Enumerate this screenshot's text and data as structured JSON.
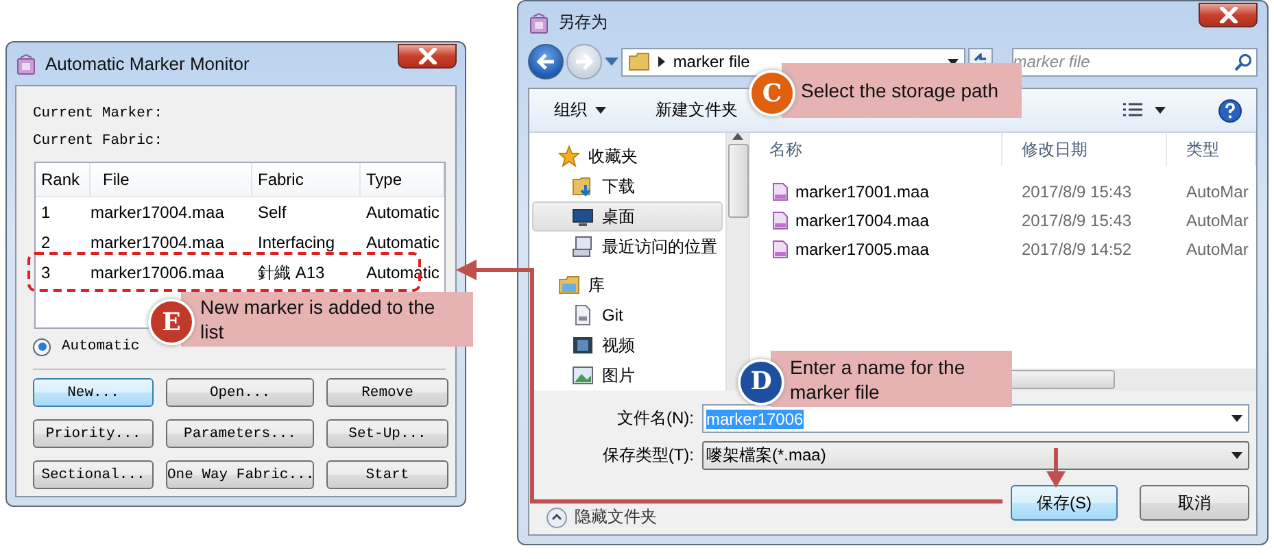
{
  "monitor": {
    "title": "Automatic Marker Monitor",
    "info": [
      "Current Marker:",
      "Current Fabric:"
    ],
    "list": {
      "columns": [
        "Rank",
        "File",
        "Fabric",
        "Type"
      ],
      "rows": [
        {
          "cells": [
            "1",
            "marker17004.maa",
            "Self",
            "Automatic"
          ]
        },
        {
          "cells": [
            "2",
            "marker17004.maa",
            "Interfacing",
            "Automatic"
          ]
        },
        {
          "cells": [
            "3",
            "marker17006.maa",
            "針織 A13",
            "Automatic"
          ]
        }
      ]
    },
    "mode": {
      "label": "Automatic",
      "selected": true
    },
    "buttons": [
      {
        "label": "New...",
        "focused": true
      },
      {
        "label": "Open...",
        "focused": false
      },
      {
        "label": "Remove",
        "focused": false
      },
      {
        "label": "Priority...",
        "focused": false
      },
      {
        "label": "Parameters...",
        "focused": false
      },
      {
        "label": "Set-Up...",
        "focused": false
      },
      {
        "label": "Sectional...",
        "focused": false
      },
      {
        "label": "One Way Fabric...",
        "focused": false
      },
      {
        "label": "Start",
        "focused": false
      }
    ]
  },
  "save_dialog": {
    "title": "另存为",
    "address": "marker file",
    "search": {
      "placeholder": "marker file"
    },
    "toolbar": [
      {
        "label": "组织",
        "menu": true
      },
      {
        "label": "新建文件夹",
        "menu": false
      }
    ],
    "nav": [
      {
        "label": "收藏夹",
        "kind": "star",
        "selected": false,
        "children": [
          {
            "label": "下载",
            "kind": "download",
            "selected": false
          },
          {
            "label": "桌面",
            "kind": "desktop",
            "selected": true
          },
          {
            "label": "最近访问的位置",
            "kind": "recent",
            "selected": false
          }
        ]
      },
      {
        "label": "库",
        "kind": "library",
        "selected": false,
        "children": [
          {
            "label": "Git",
            "kind": "git",
            "selected": false
          },
          {
            "label": "视频",
            "kind": "video",
            "selected": false
          },
          {
            "label": "图片",
            "kind": "image",
            "selected": false
          }
        ]
      }
    ],
    "file_list": {
      "columns": [
        "名称",
        "修改日期",
        "类型"
      ],
      "rows": [
        {
          "cells": [
            "marker17001.maa",
            "2017/8/9 15:43",
            "AutoMar"
          ]
        },
        {
          "cells": [
            "marker17004.maa",
            "2017/8/9 15:43",
            "AutoMar"
          ]
        },
        {
          "cells": [
            "marker17005.maa",
            "2017/8/9 14:52",
            "AutoMar"
          ]
        }
      ]
    },
    "filename": {
      "label": "文件名(N):",
      "value": "marker17006"
    },
    "file_type": {
      "label": "保存类型(T):",
      "value": "嘜架檔案(*.maa)"
    },
    "hide_folders": "隐藏文件夹",
    "buttons": [
      {
        "label": "保存(S)",
        "default": true
      },
      {
        "label": "取消",
        "default": false
      }
    ]
  },
  "callouts": [
    {
      "badge": "C",
      "text": "Select the storage path",
      "color": "#e0600e"
    },
    {
      "badge": "D",
      "text": "Enter a name for the marker file",
      "color": "#1d4f9e"
    },
    {
      "badge": "E",
      "text": "New marker is added to the list",
      "color": "#c0392b"
    }
  ]
}
